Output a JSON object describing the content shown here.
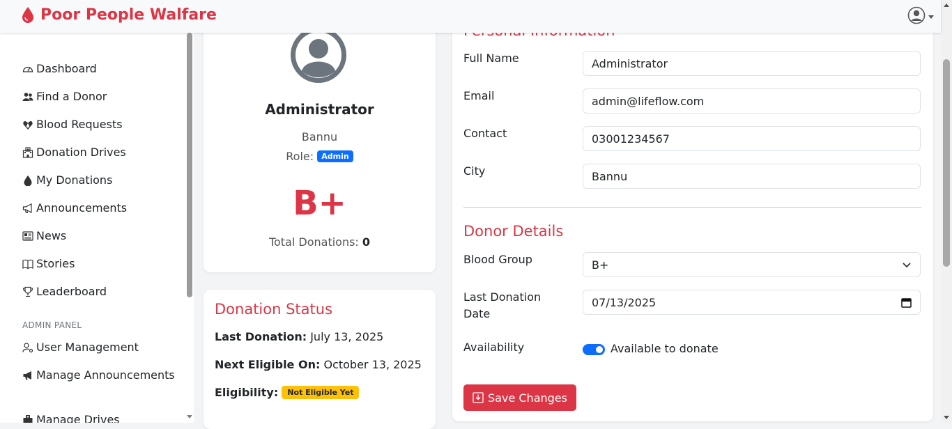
{
  "app": {
    "brand": "Poor People Walfare"
  },
  "sidebar": {
    "items": [
      {
        "label": "Dashboard",
        "icon": "speedometer-icon"
      },
      {
        "label": "Find a Donor",
        "icon": "people-icon"
      },
      {
        "label": "Blood Requests",
        "icon": "heart-drop-icon"
      },
      {
        "label": "Donation Drives",
        "icon": "hospital-icon"
      },
      {
        "label": "My Donations",
        "icon": "droplet-icon"
      },
      {
        "label": "Announcements",
        "icon": "megaphone-icon"
      },
      {
        "label": "News",
        "icon": "newspaper-icon"
      },
      {
        "label": "Stories",
        "icon": "book-icon"
      },
      {
        "label": "Leaderboard",
        "icon": "trophy-icon"
      }
    ],
    "admin_heading": "ADMIN PANEL",
    "admin_items": [
      {
        "label": "User Management",
        "icon": "person-gear-icon"
      },
      {
        "label": "Manage Announcements",
        "icon": "megaphone-fill-icon"
      },
      {
        "label": "Manage Drives",
        "icon": "hospital-fill-icon"
      }
    ]
  },
  "profile": {
    "name": "Administrator",
    "city": "Bannu",
    "role_label": "Role:",
    "role_badge": "Admin",
    "blood_group": "B+",
    "total_label": "Total Donations:",
    "total_value": "0"
  },
  "status": {
    "title": "Donation Status",
    "last_label": "Last Donation:",
    "last_value": "July 13, 2025",
    "next_label": "Next Eligible On:",
    "next_value": "October 13, 2025",
    "elig_label": "Eligibility:",
    "elig_badge": "Not Eligible Yet"
  },
  "form": {
    "personal_title": "Personal Information",
    "full_name_label": "Full Name",
    "full_name_value": "Administrator",
    "email_label": "Email",
    "email_value": "admin@lifeflow.com",
    "contact_label": "Contact",
    "contact_value": "03001234567",
    "city_label": "City",
    "city_value": "Bannu",
    "donor_title": "Donor Details",
    "blood_label": "Blood Group",
    "blood_value": "B+",
    "last_date_label": "Last Donation Date",
    "last_date_value": "07/13/2025",
    "availability_label": "Availability",
    "availability_text": "Available to donate",
    "availability_on": true,
    "save_label": "Save Changes"
  },
  "colors": {
    "brand": "#dc3545",
    "primary": "#0d6efd",
    "warning": "#ffc107"
  }
}
